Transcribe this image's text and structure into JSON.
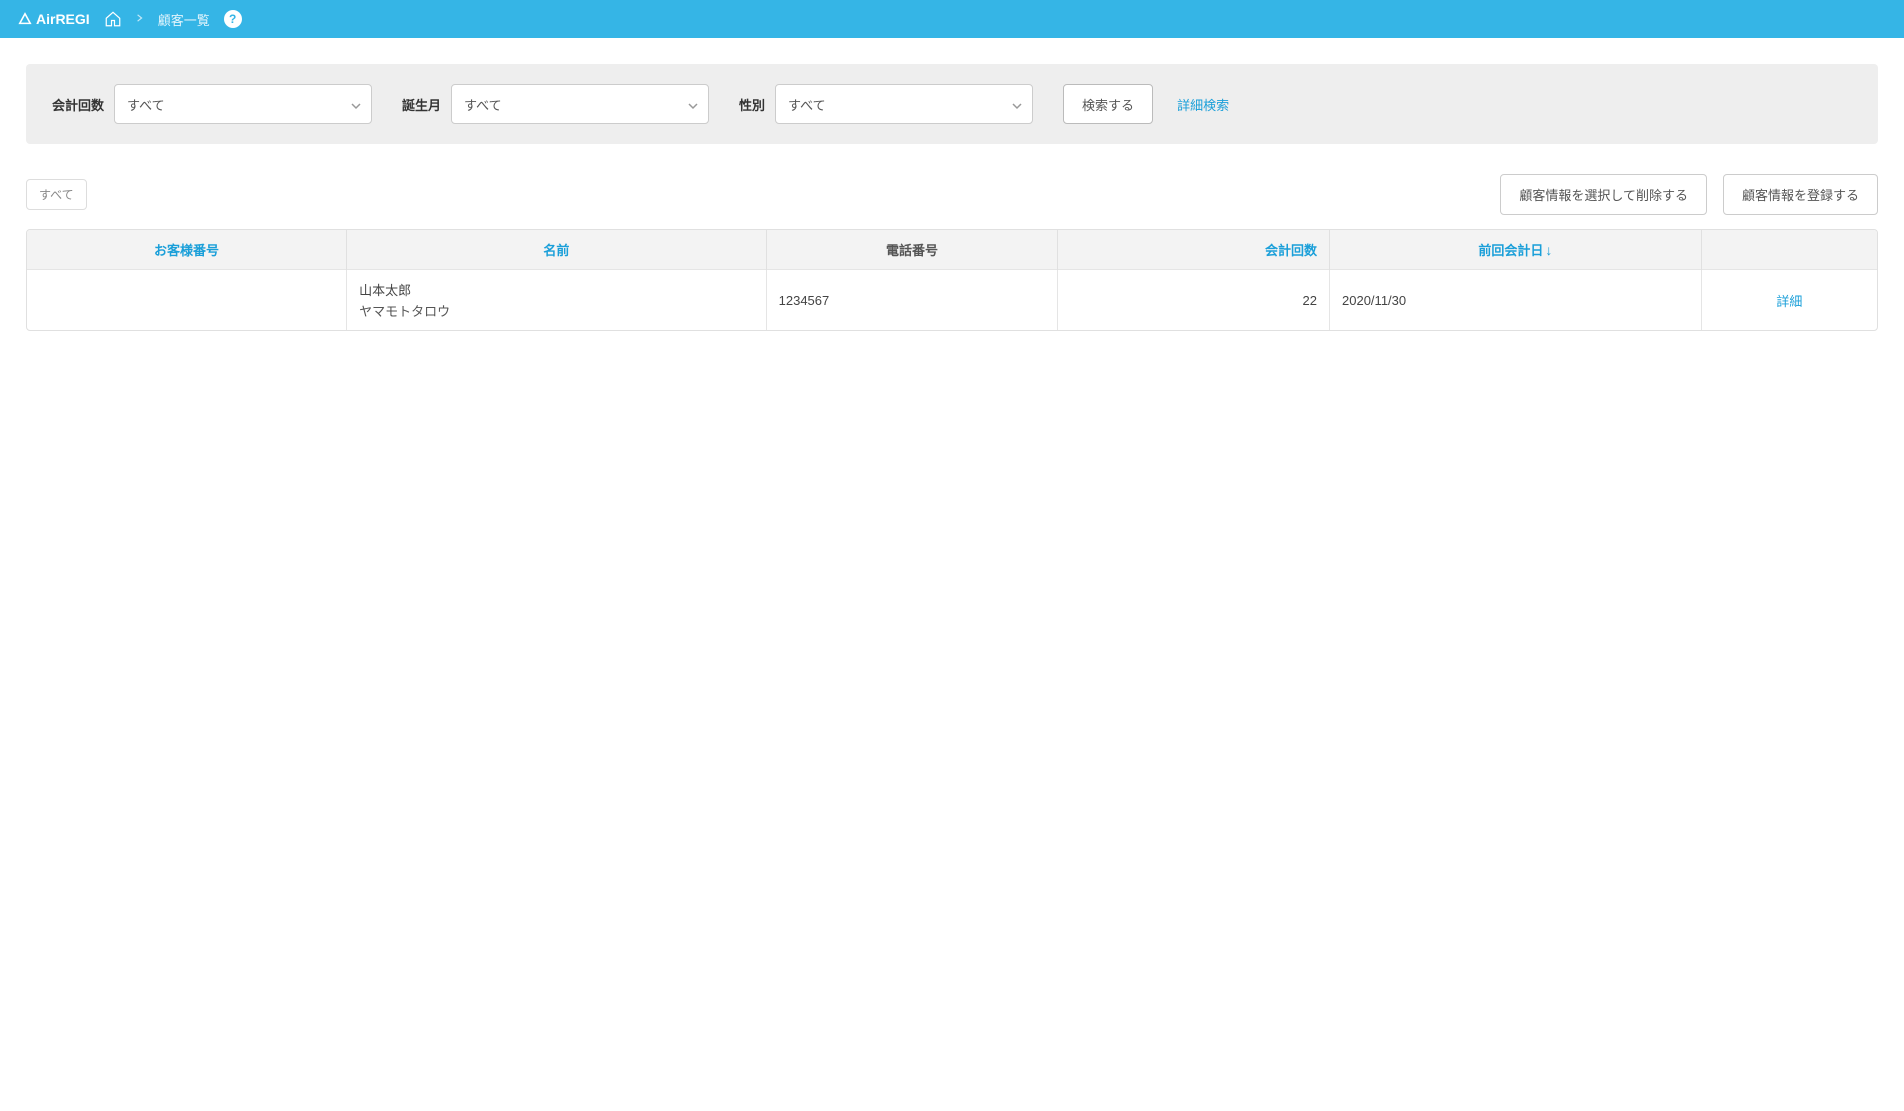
{
  "header": {
    "logo_text": "AirREGI",
    "breadcrumb": "顧客一覧"
  },
  "filters": {
    "count_label": "会計回数",
    "count_value": "すべて",
    "birth_label": "誕生月",
    "birth_value": "すべて",
    "gender_label": "性別",
    "gender_value": "すべて",
    "search_btn": "検索する",
    "advanced_link": "詳細検索"
  },
  "toolbar": {
    "filter_tab": "すべて",
    "delete_btn": "顧客情報を選択して削除する",
    "register_btn": "顧客情報を登録する"
  },
  "table": {
    "headers": {
      "customer_no": "お客様番号",
      "name": "名前",
      "phone": "電話番号",
      "count": "会計回数",
      "last_date": "前回会計日",
      "action": ""
    },
    "rows": [
      {
        "customer_no": "",
        "name": "山本太郎",
        "name_kana": "ヤマモトタロウ",
        "phone": "1234567",
        "count": "22",
        "last_date": "2020/11/30",
        "action": "詳細"
      }
    ]
  }
}
